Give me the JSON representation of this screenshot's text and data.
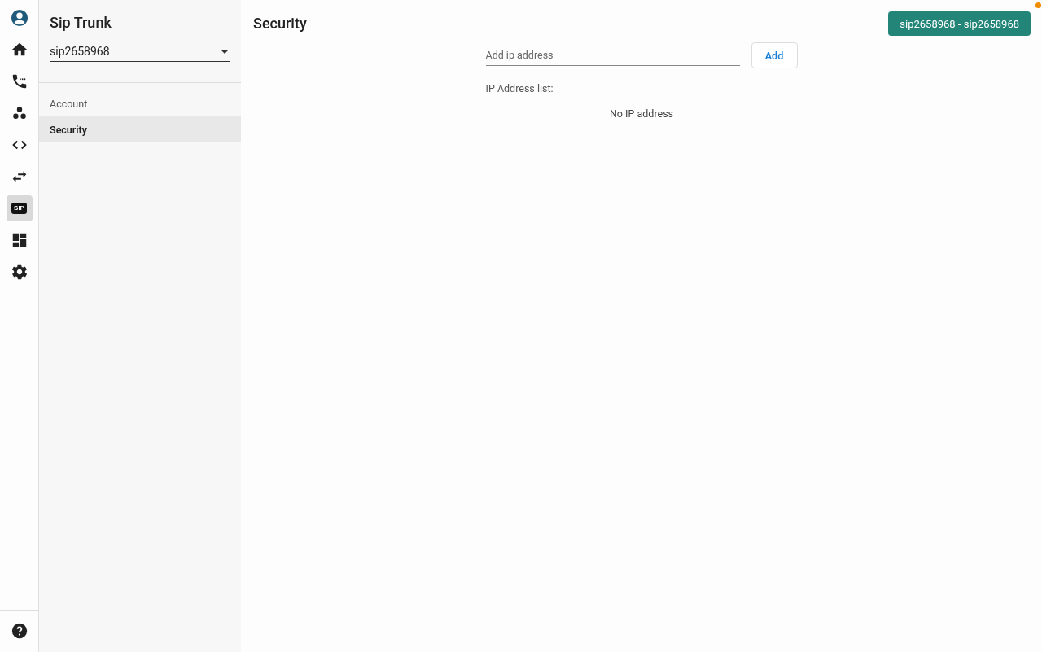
{
  "rail": {
    "top": [
      {
        "kind": "avatar",
        "selected": false
      },
      {
        "kind": "home",
        "selected": false
      },
      {
        "kind": "phone",
        "selected": false
      },
      {
        "kind": "dots",
        "selected": false
      },
      {
        "kind": "code",
        "selected": false
      },
      {
        "kind": "swap",
        "selected": false
      },
      {
        "kind": "sip",
        "label": "SIP",
        "selected": true
      },
      {
        "kind": "dashboard",
        "selected": false
      },
      {
        "kind": "gear",
        "selected": false
      }
    ],
    "bottom": [
      {
        "kind": "help",
        "selected": false
      }
    ]
  },
  "sidebar": {
    "title": "Sip Trunk",
    "select_value": "sip2658968",
    "items": [
      {
        "label": "Account",
        "selected": false
      },
      {
        "label": "Security",
        "selected": true
      }
    ]
  },
  "main": {
    "title": "Security",
    "account_button": "sip2658968 - sip2658968",
    "ip_field": {
      "placeholder": "Add ip address"
    },
    "add_button": "Add",
    "list_label": "IP Address list:",
    "empty_text": "No IP address"
  }
}
